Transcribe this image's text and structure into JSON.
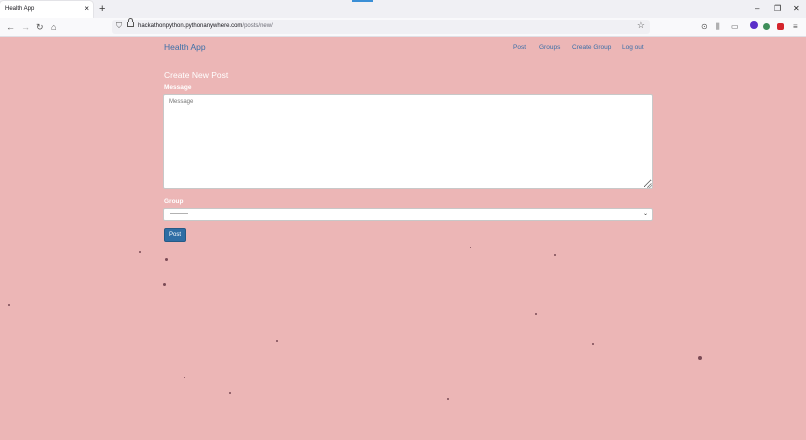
{
  "browser": {
    "tab_title": "Health App",
    "tab_close_icon": "×",
    "new_tab_icon": "+",
    "window_controls": [
      "–",
      "❐",
      "✕"
    ],
    "url_host": "hackathonpython.pythonanywhere.com",
    "url_path": "/posts/new/"
  },
  "navbar": {
    "brand": "Health App",
    "links": [
      "Post",
      "Groups",
      "Create Group",
      "Log out"
    ]
  },
  "form": {
    "heading": "Create New Post",
    "message_label": "Message",
    "message_placeholder": "Message",
    "group_label": "Group",
    "group_selected": "---------",
    "submit_label": "Post"
  },
  "colors": {
    "page_background": "#ecb6b6",
    "link": "#3a6fa8",
    "button": "#2e6da4"
  }
}
